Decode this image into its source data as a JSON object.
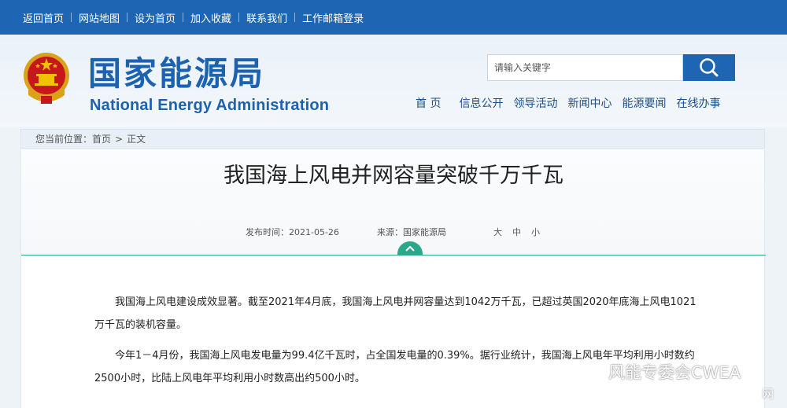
{
  "topbar": {
    "links": [
      "返回首页",
      "网站地图",
      "设为首页",
      "加入收藏",
      "联系我们",
      "工作邮箱登录"
    ]
  },
  "header": {
    "logo_cn": "国家能源局",
    "logo_en": "National Energy Administration",
    "search_placeholder": "请输入关键字",
    "nav": [
      "首 页",
      "信息公开",
      "领导活动",
      "新闻中心",
      "能源要闻",
      "在线办事"
    ]
  },
  "breadcrumb": {
    "label": "您当前位置：",
    "home": "首页",
    "arrow": ">",
    "current": "正文"
  },
  "article": {
    "title": "我国海上风电并网容量突破千万千瓦",
    "publish_label": "发布时间：",
    "publish_date": "2021-05-26",
    "source_label": "来源：",
    "source": "国家能源局",
    "font_sizes": [
      "大",
      "中",
      "小"
    ],
    "paragraphs": [
      "我国海上风电建设成效显著。截至2021年4月底，我国海上风电并网容量达到1042万千瓦，已超过英国2020年底海上风电1021万千瓦的装机容量。",
      "今年1－4月份，我国海上风电发电量为99.4亿千瓦时，占全国发电量的0.39%。据行业统计，我国海上风电年平均利用小时数约2500小时，比陆上风电年平均利用小时数高出约500小时。"
    ]
  },
  "watermark": {
    "text": "风能专委会CWEA",
    "corner": "网"
  },
  "colors": {
    "topbar": "#1e66b3",
    "brand_blue": "#1d62b0",
    "accent_green": "#2aa88a"
  }
}
